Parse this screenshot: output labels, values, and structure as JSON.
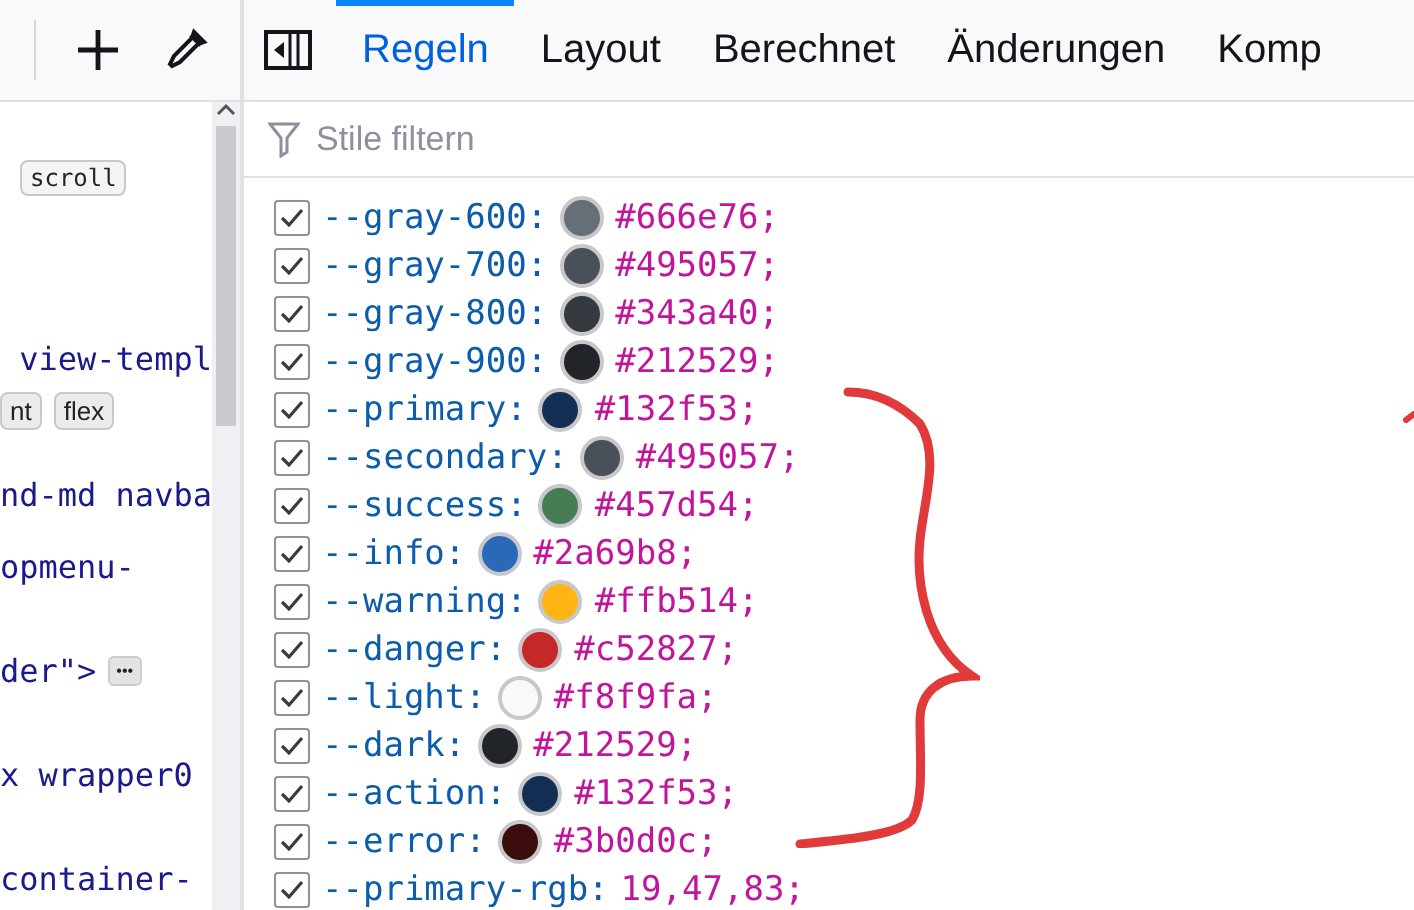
{
  "markup_panel": {
    "lines": [
      {
        "segments": [
          {
            "kind": "badge",
            "text": "scroll"
          }
        ]
      },
      {
        "segments": [
          {
            "kind": "code",
            "text": " view-templ"
          }
        ]
      },
      {
        "segments": [
          {
            "kind": "badge",
            "text": "nt"
          },
          {
            "kind": "badge",
            "text": "flex"
          }
        ]
      },
      {
        "segments": [
          {
            "kind": "code",
            "text": "nd-md navba"
          }
        ]
      },
      {
        "segments": [
          {
            "kind": "code",
            "text": "opmenu-"
          }
        ]
      },
      {
        "segments": [
          {
            "kind": "code",
            "text": "der\">"
          },
          {
            "kind": "ellipsis",
            "text": "•••"
          }
        ]
      },
      {
        "segments": [
          {
            "kind": "code",
            "text": "x wrapper0"
          }
        ]
      },
      {
        "segments": [
          {
            "kind": "code",
            "text": "container-"
          }
        ]
      }
    ]
  },
  "tabs": [
    {
      "label": "Regeln",
      "selected": true
    },
    {
      "label": "Layout",
      "selected": false
    },
    {
      "label": "Berechnet",
      "selected": false
    },
    {
      "label": "Änderungen",
      "selected": false
    },
    {
      "label": "Komp",
      "selected": false
    }
  ],
  "filter": {
    "placeholder": "Stile filtern"
  },
  "declarations": [
    {
      "name": "--gray-600:",
      "value": "#666e76;",
      "checked": true,
      "color": "#666e76"
    },
    {
      "name": "--gray-700:",
      "value": "#495057;",
      "checked": true,
      "color": "#495057"
    },
    {
      "name": "--gray-800:",
      "value": "#343a40;",
      "checked": true,
      "color": "#343a40"
    },
    {
      "name": "--gray-900:",
      "value": "#212529;",
      "checked": true,
      "color": "#212529"
    },
    {
      "name": "--primary:",
      "value": "#132f53;",
      "checked": true,
      "color": "#132f53"
    },
    {
      "name": "--secondary:",
      "value": "#495057;",
      "checked": true,
      "color": "#495057"
    },
    {
      "name": "--success:",
      "value": "#457d54;",
      "checked": true,
      "color": "#457d54"
    },
    {
      "name": "--info:",
      "value": "#2a69b8;",
      "checked": true,
      "color": "#2a69b8"
    },
    {
      "name": "--warning:",
      "value": "#ffb514;",
      "checked": true,
      "color": "#ffb514"
    },
    {
      "name": "--danger:",
      "value": "#c52827;",
      "checked": true,
      "color": "#c52827"
    },
    {
      "name": "--light:",
      "value": "#f8f9fa;",
      "checked": true,
      "color": "#f8f9fa"
    },
    {
      "name": "--dark:",
      "value": "#212529;",
      "checked": true,
      "color": "#212529"
    },
    {
      "name": "--action:",
      "value": "#132f53;",
      "checked": true,
      "color": "#132f53"
    },
    {
      "name": "--error:",
      "value": "#3b0d0c;",
      "checked": true,
      "color": "#3b0d0c"
    },
    {
      "name": "--primary-rgb:",
      "value": "19,47,83;",
      "checked": true
    }
  ]
}
